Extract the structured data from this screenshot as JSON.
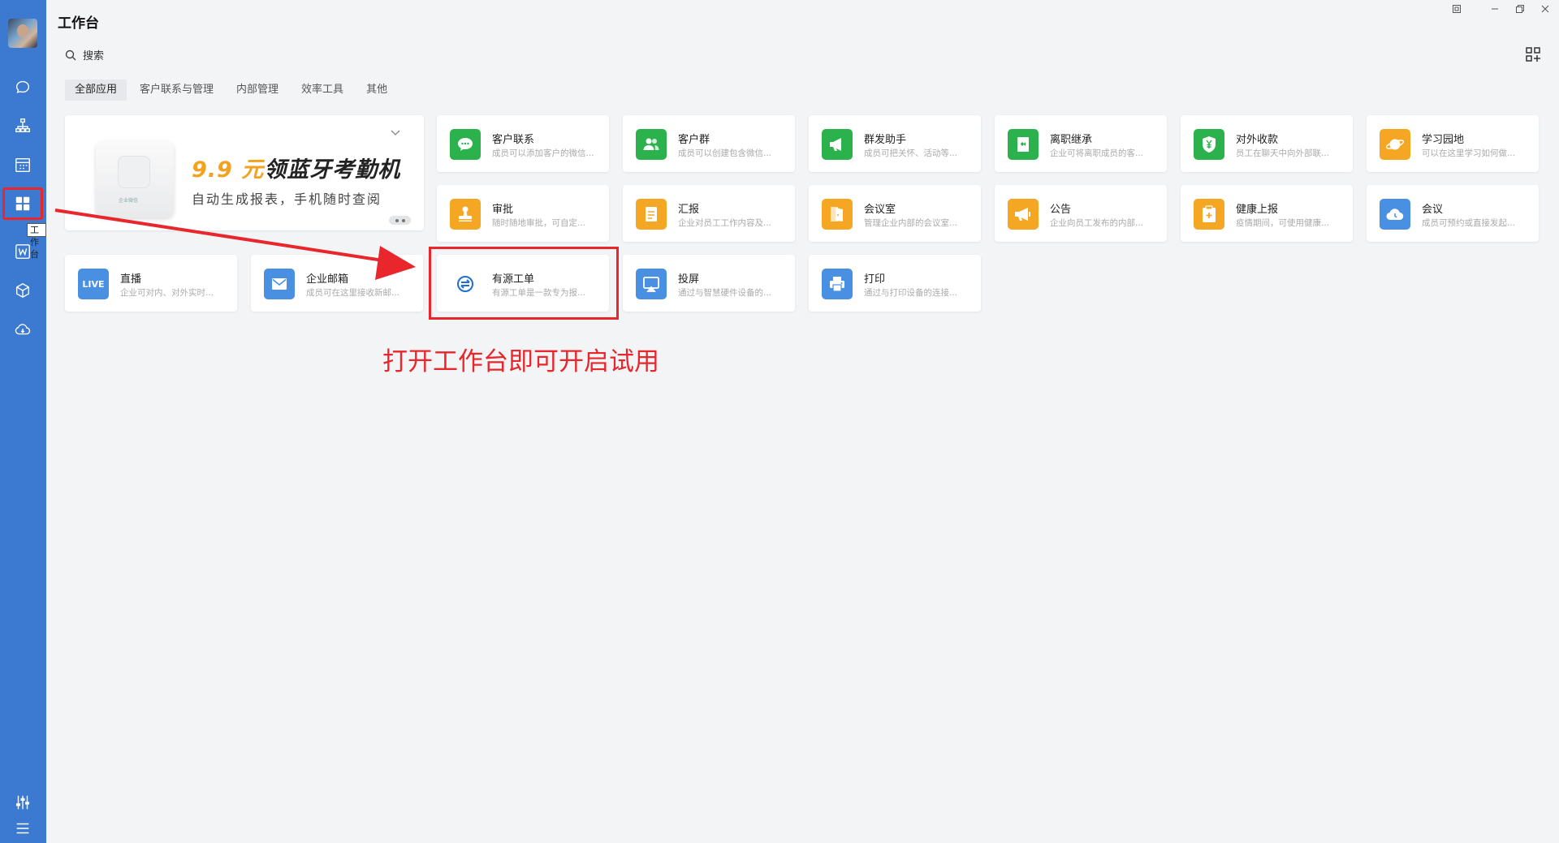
{
  "window": {
    "title": "工作台"
  },
  "sidebar": {
    "tooltip": "工作台",
    "items": [
      {
        "icon": "chat-icon"
      },
      {
        "icon": "contacts-icon"
      },
      {
        "icon": "calendar-icon"
      },
      {
        "icon": "workbench-grid-icon",
        "active": true
      },
      {
        "icon": "docs-w-icon"
      },
      {
        "icon": "cube-icon"
      },
      {
        "icon": "cloud-drive-icon"
      }
    ],
    "bottom": [
      {
        "icon": "settings-sliders-icon"
      },
      {
        "icon": "menu-icon"
      }
    ]
  },
  "search": {
    "label": "搜索"
  },
  "tabs": [
    {
      "label": "全部应用",
      "active": true
    },
    {
      "label": "客户联系与管理"
    },
    {
      "label": "内部管理"
    },
    {
      "label": "效率工具"
    },
    {
      "label": "其他"
    }
  ],
  "banner": {
    "price": "9.9 元",
    "title_rest": "领蓝牙考勤机",
    "subtitle": "自动生成报表，手机随时查阅",
    "device_brand": "企业微信"
  },
  "apps": [
    {
      "name": "客户联系",
      "desc": "成员可以添加客户的微信...",
      "color": "#2bb24c",
      "icon": "chat-bubble-icon"
    },
    {
      "name": "客户群",
      "desc": "成员可以创建包含微信...",
      "color": "#2bb24c",
      "icon": "group-icon"
    },
    {
      "name": "群发助手",
      "desc": "成员可把关怀、活动等...",
      "color": "#2bb24c",
      "icon": "megaphone-icon"
    },
    {
      "name": "离职继承",
      "desc": "企业可将离职成员的客...",
      "color": "#2bb24c",
      "icon": "handover-icon"
    },
    {
      "name": "对外收款",
      "desc": "员工在聊天中向外部联...",
      "color": "#2bb24c",
      "icon": "yuan-shield-icon"
    },
    {
      "name": "学习园地",
      "desc": "可以在这里学习如何做...",
      "color": "#f5a623",
      "icon": "planet-icon"
    },
    {
      "name": "审批",
      "desc": "随时随地审批，可自定...",
      "color": "#f5a623",
      "icon": "stamp-icon"
    },
    {
      "name": "汇报",
      "desc": "企业对员工工作内容及...",
      "color": "#f5a623",
      "icon": "report-icon"
    },
    {
      "name": "会议室",
      "desc": "管理企业内部的会议室...",
      "color": "#f5a623",
      "icon": "door-icon"
    },
    {
      "name": "公告",
      "desc": "企业向员工发布的内部...",
      "color": "#f5a623",
      "icon": "announce-icon"
    },
    {
      "name": "健康上报",
      "desc": "疫情期间，可使用健康...",
      "color": "#f5a623",
      "icon": "health-clipboard-icon"
    },
    {
      "name": "会议",
      "desc": "成员可预约或直接发起...",
      "color": "#4a90e2",
      "icon": "cloud-meeting-icon"
    },
    {
      "name": "直播",
      "desc": "企业可对内、对外实时...",
      "color": "#4a90e2",
      "icon": "live-icon",
      "badge": "LIVE"
    },
    {
      "name": "企业邮箱",
      "desc": "成员可在这里接收新邮...",
      "color": "#4a90e2",
      "icon": "mail-icon"
    },
    {
      "name": "有源工单",
      "desc": "有源工单是一款专为报...",
      "color": "#ffffff",
      "icon": "youyuan-logo-icon"
    },
    {
      "name": "投屏",
      "desc": "通过与智慧硬件设备的...",
      "color": "#4a90e2",
      "icon": "screen-cast-icon"
    },
    {
      "name": "打印",
      "desc": "通过与打印设备的连接...",
      "color": "#4a90e2",
      "icon": "printer-icon"
    }
  ],
  "annotation": {
    "text": "打开工作台即可开启试用",
    "color": "#e8262b"
  }
}
